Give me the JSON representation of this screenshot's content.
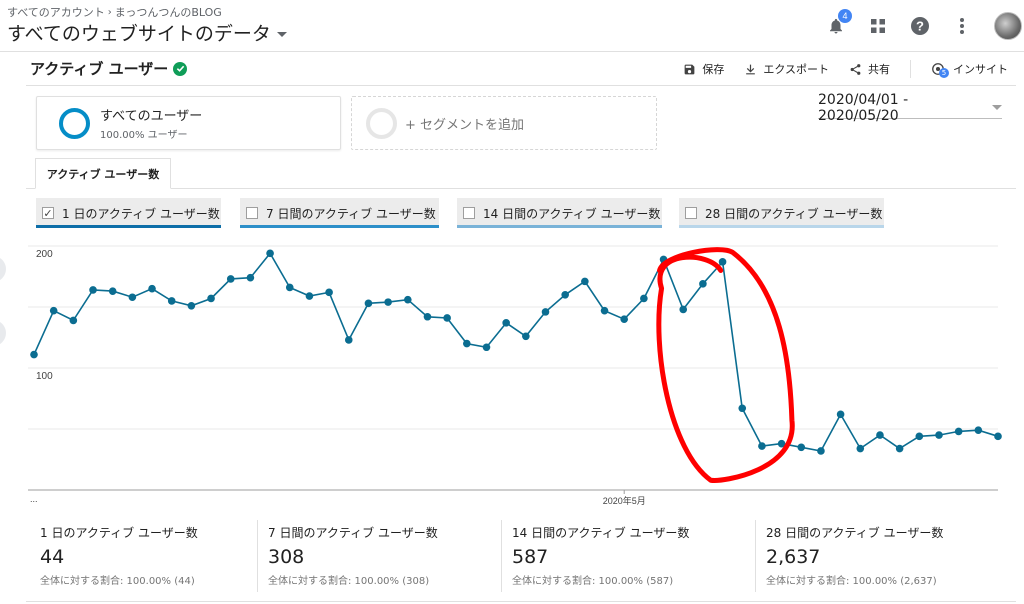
{
  "header": {
    "breadcrumb": [
      "すべてのアカウント",
      "まっつんつんのBLOG"
    ],
    "view_title": "すべてのウェブサイトのデータ",
    "notification_count": "4"
  },
  "report": {
    "title": "アクティブ ユーザー",
    "actions": {
      "save": "保存",
      "export": "エクスポート",
      "share": "共有",
      "insights": "インサイト",
      "insights_badge": "5"
    }
  },
  "segments": {
    "all_users": {
      "name": "すべてのユーザー",
      "share": "100.00% ユーザー"
    },
    "add_segment": "+ セグメントを追加"
  },
  "date_range": "2020/04/01 - 2020/05/20",
  "tab": "アクティブ ユーザー数",
  "metric_toggles": [
    {
      "label": "1 日のアクティブ ユーザー数",
      "checked": true,
      "color": "#0d6ea8"
    },
    {
      "label": "7 日間のアクティブ ユーザー数",
      "checked": false,
      "color": "#2d8fc9"
    },
    {
      "label": "14 日間のアクティブ ユーザー数",
      "checked": false,
      "color": "#7ab3d8"
    },
    {
      "label": "28 日間のアクティブ ユーザー数",
      "checked": false,
      "color": "#b9d6ea"
    }
  ],
  "colors": {
    "series": "#0b6d91",
    "highlight_circle": "#ff0000",
    "ring": "#058dc7"
  },
  "chart_data": {
    "type": "line",
    "x_start_label": "...",
    "x_tick_label": "2020年5月",
    "y_ticks": [
      100,
      200
    ],
    "ylim": [
      0,
      200
    ],
    "grid": true,
    "series": [
      {
        "values": [
          111,
          147,
          139,
          164,
          163,
          158,
          165,
          155,
          151,
          157,
          173,
          174,
          194,
          166,
          159,
          162,
          123,
          153,
          154,
          156,
          142,
          141,
          120,
          117,
          137,
          126,
          146,
          160,
          171,
          147,
          140,
          157,
          189,
          148,
          169,
          187,
          67,
          36,
          38,
          35,
          32,
          62,
          34,
          45,
          34,
          44,
          45,
          48,
          49,
          44
        ]
      }
    ]
  },
  "scorecards": [
    {
      "label": "1 日のアクティブ ユーザー数",
      "value": "44",
      "share": "全体に対する割合: 100.00% (44)"
    },
    {
      "label": "7 日間のアクティブ ユーザー数",
      "value": "308",
      "share": "全体に対する割合: 100.00% (308)"
    },
    {
      "label": "14 日間のアクティブ ユーザー数",
      "value": "587",
      "share": "全体に対する割合: 100.00% (587)"
    },
    {
      "label": "28 日間のアクティブ ユーザー数",
      "value": "2,637",
      "share": "全体に対する割合: 100.00% (2,637)"
    }
  ]
}
